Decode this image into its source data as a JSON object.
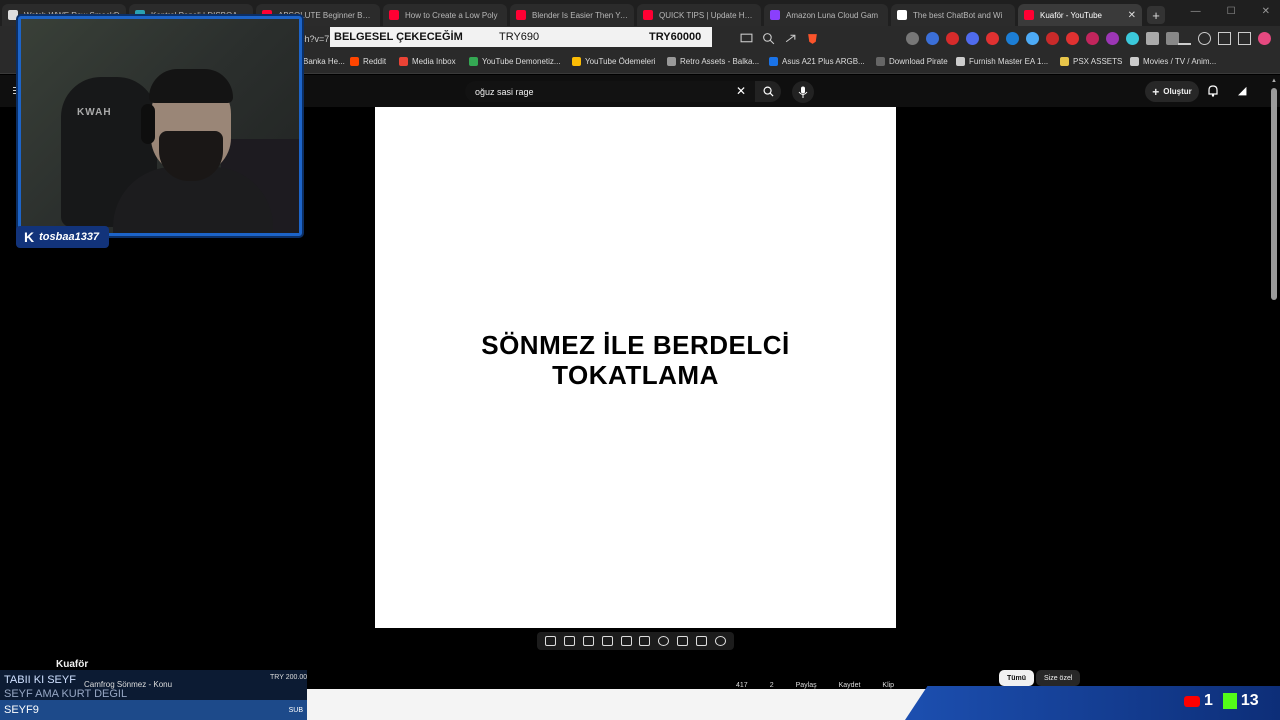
{
  "browser": {
    "tabs": [
      {
        "title": "Watch WWE Raw SmackD",
        "color": "#dddddd",
        "active": false
      },
      {
        "title": "Kontrol Paneli | DISBOARD",
        "color": "#2aa1b3",
        "active": false
      },
      {
        "title": "ABSOLUTE Beginner Basic",
        "color": "#ff0033",
        "active": false
      },
      {
        "title": "How to Create a Low Poly",
        "color": "#ff0033",
        "active": false
      },
      {
        "title": "Blender Is Easier Then You",
        "color": "#ff0033",
        "active": false
      },
      {
        "title": "QUICK TIPS | Update Hand",
        "color": "#ff0033",
        "active": false
      },
      {
        "title": "Amazon Luna Cloud Gam",
        "color": "#8a3ffc",
        "active": false
      },
      {
        "title": "The best ChatBot and Wi",
        "color": "#ffffff",
        "active": false
      },
      {
        "title": "Kuaför - YouTube",
        "color": "#ff0033",
        "active": true
      }
    ],
    "new_tab": "+",
    "url_fragment": "ch?v=7",
    "bookmarks": [
      {
        "label": "Banka He...",
        "color": "#777777"
      },
      {
        "label": "Reddit",
        "color": "#ff4500"
      },
      {
        "label": "Media Inbox",
        "color": "#ea4335"
      },
      {
        "label": "YouTube Demonetiz...",
        "color": "#34a853"
      },
      {
        "label": "YouTube Ödemeleri",
        "color": "#fbbc05"
      },
      {
        "label": "Retro Assets - Balka...",
        "color": "#999999"
      },
      {
        "label": "Asus A21 Plus ARGB...",
        "color": "#1a73e8"
      },
      {
        "label": "Download Pirate",
        "color": "#666666"
      },
      {
        "label": "Furnish Master EA 1...",
        "color": "#cccccc"
      },
      {
        "label": "PSX ASSETS",
        "color": "#e8c54a"
      },
      {
        "label": "Movies / TV / Anim...",
        "color": "#cccccc"
      }
    ]
  },
  "promo_banner": {
    "text1": "BELGESEL ÇEKECEĞİM",
    "text2": "TRY690",
    "text3": "TRY60000"
  },
  "youtube": {
    "search_value": "oğuz sasi rage",
    "create_label": "Oluştur",
    "video_text": "SÖNMEZ İLE BERDELCİ TOKATLAMA",
    "video_name": "Kuaför",
    "actions": [
      "417",
      "2",
      "Paylaş",
      "Kaydet",
      "Klip"
    ],
    "chips": {
      "all": "Tümü",
      "for_you": "Size özel"
    }
  },
  "stream": {
    "cam_name": "tosbaa1337",
    "chair_text": "KWAH",
    "ticker_line1": "TABII KI SEYF",
    "ticker_line2": "SEYF AMA KURT DEGIL",
    "ticker_amount": "TRY 200.00",
    "ticker_sub_item": "Camfrog Sönmez - Konu",
    "bar_name": "SEYF9",
    "bar_tag": "SUB",
    "youtube_viewers": "1",
    "kick_viewers": "13"
  }
}
